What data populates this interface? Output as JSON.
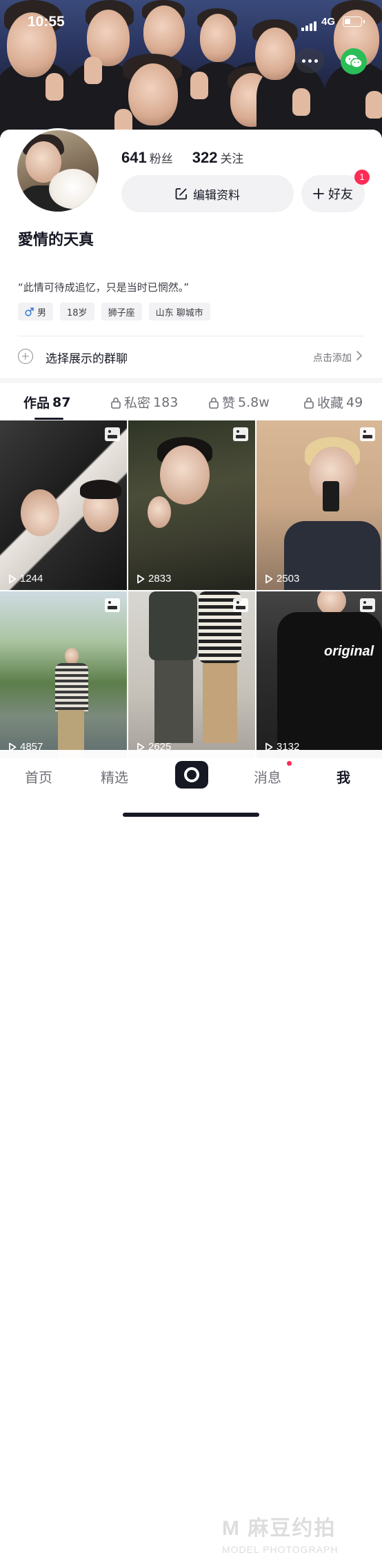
{
  "status_bar": {
    "time": "10:55",
    "network": "4G"
  },
  "header": {
    "more_icon": "more-dots-icon",
    "share_icon": "wechat-icon"
  },
  "profile": {
    "followers_count": "641",
    "followers_label": "粉丝",
    "following_count": "322",
    "following_label": "关注",
    "edit_button_label": "编辑资料",
    "friend_button_label": "好友",
    "friend_badge": "1",
    "nickname": "愛情的天真",
    "signature": "“此情可待成追忆，只是当时已惘然。”",
    "tags": [
      {
        "label": "男",
        "icon": "male-icon"
      },
      {
        "label": "18岁"
      },
      {
        "label": "狮子座"
      },
      {
        "label": "山东 聊城市"
      }
    ],
    "group_row_label": "选择展示的群聊",
    "group_row_hint": "点击添加"
  },
  "tabs": [
    {
      "label": "作品",
      "count": "87",
      "active": true
    },
    {
      "label": "私密",
      "count": "183",
      "locked": true
    },
    {
      "label": "赞",
      "count": "5.8w",
      "locked": true
    },
    {
      "label": "收藏",
      "count": "49",
      "locked": true
    }
  ],
  "videos": [
    {
      "plays": "1244",
      "has_gallery_icon": true
    },
    {
      "plays": "2833",
      "has_gallery_icon": true
    },
    {
      "plays": "2503",
      "has_gallery_icon": true
    },
    {
      "plays": "4857",
      "has_gallery_icon": true
    },
    {
      "plays": "2625",
      "has_gallery_icon": true
    },
    {
      "plays": "3132",
      "has_gallery_icon": true
    }
  ],
  "bottom_nav": [
    {
      "label": "首页"
    },
    {
      "label": "精选"
    },
    {
      "label": "",
      "icon": "create-icon"
    },
    {
      "label": "消息",
      "has_dot": true
    },
    {
      "label": "我",
      "active": true
    }
  ],
  "watermark": {
    "main": "M 麻豆约拍",
    "sub": "MODEL PHOTOGRAPH"
  },
  "colors": {
    "accent": "#fe2c55",
    "wechat": "#2bbd57",
    "text_primary": "#161823",
    "text_secondary": "#6f7078",
    "chip_bg": "#f2f2f4"
  }
}
